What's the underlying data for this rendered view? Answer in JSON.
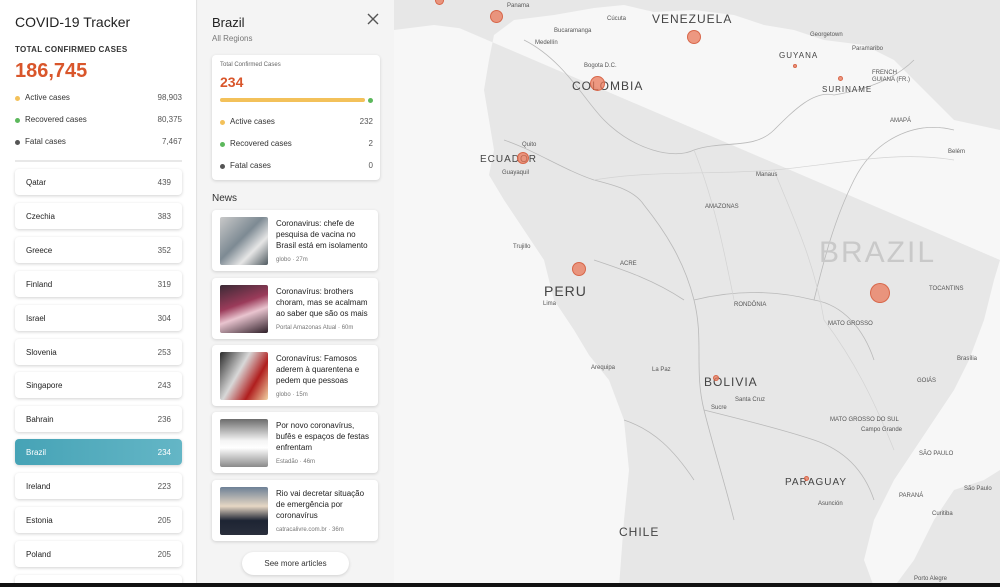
{
  "app": {
    "title": "COVID-19 Tracker"
  },
  "summary": {
    "label": "TOTAL CONFIRMED CASES",
    "value": "186,745",
    "stats": [
      {
        "label": "Active cases",
        "value": "98,903",
        "color": "#f3c15a"
      },
      {
        "label": "Recovered cases",
        "value": "80,375",
        "color": "#5cb85c"
      },
      {
        "label": "Fatal cases",
        "value": "7,467",
        "color": "#555555"
      }
    ]
  },
  "countries": [
    {
      "name": "Qatar",
      "value": "439"
    },
    {
      "name": "Czechia",
      "value": "383"
    },
    {
      "name": "Greece",
      "value": "352"
    },
    {
      "name": "Finland",
      "value": "319"
    },
    {
      "name": "Israel",
      "value": "304"
    },
    {
      "name": "Slovenia",
      "value": "253"
    },
    {
      "name": "Singapore",
      "value": "243"
    },
    {
      "name": "Bahrain",
      "value": "236"
    },
    {
      "name": "Brazil",
      "value": "234",
      "active": true
    },
    {
      "name": "Ireland",
      "value": "223"
    },
    {
      "name": "Estonia",
      "value": "205"
    },
    {
      "name": "Poland",
      "value": "205"
    }
  ],
  "detail": {
    "title": "Brazil",
    "subtitle": "All Regions",
    "card_label": "Total Confirmed Cases",
    "card_value": "234",
    "stats": [
      {
        "label": "Active cases",
        "value": "232",
        "color": "#f3c15a"
      },
      {
        "label": "Recovered cases",
        "value": "2",
        "color": "#5cb85c"
      },
      {
        "label": "Fatal cases",
        "value": "0",
        "color": "#555555"
      }
    ]
  },
  "news": {
    "heading": "News",
    "items": [
      {
        "title": "Coronavirus: chefe de pesquisa de vacina no Brasil está em isolamento",
        "source": "globo",
        "time": "27m"
      },
      {
        "title": "Coronavírus: brothers choram, mas se acalmam ao saber que são os mais",
        "source": "Portal Amazonas Atual",
        "time": "60m"
      },
      {
        "title": "Coronavírus: Famosos aderem à quarentena e pedem que pessoas",
        "source": "globo",
        "time": "15m"
      },
      {
        "title": "Por novo coronavírus, bufês e espaços de festas enfrentam",
        "source": "Estadão",
        "time": "46m"
      },
      {
        "title": "Rio vai decretar situação de emergência por coronavírus",
        "source": "catracalivre.com.br",
        "time": "36m"
      }
    ],
    "see_more": "See more articles"
  },
  "map": {
    "country_labels": [
      "VENEZUELA",
      "COLOMBIA",
      "ECUADOR",
      "PERU",
      "BOLIVIA",
      "PARAGUAY",
      "CHILE",
      "GUYANA",
      "SURINAME"
    ],
    "big_label": "BRAZIL",
    "city_labels": [
      "Panama",
      "Cúcuta",
      "Bucaramanga",
      "Medellín",
      "Bogota D.C.",
      "Georgetown",
      "Paramaribo",
      "FRENCH GUIANA (FR.)",
      "AMAPÁ",
      "Belém",
      "Quito",
      "Guayaquil",
      "Manaus",
      "AMAZONAS",
      "Trujillo",
      "ACRE",
      "Lima",
      "RONDÔNIA",
      "MATO GROSSO",
      "TOCANTINS",
      "Brasília",
      "GOIÁS",
      "Arequipa",
      "La Paz",
      "Santa Cruz",
      "Sucre",
      "MATO GROSSO DO SUL",
      "Campo Grande",
      "SÃO PAULO",
      "Asunción",
      "São Paulo",
      "PARANÁ",
      "Curitiba",
      "Porto Alegre"
    ]
  }
}
